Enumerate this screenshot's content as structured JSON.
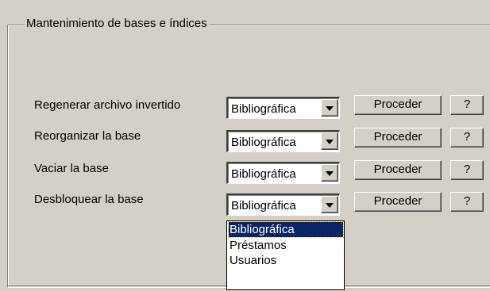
{
  "group": {
    "title": "Mantenimiento de bases e índices"
  },
  "rows": [
    {
      "label": "Regenerar archivo invertido",
      "combo_value": "Bibliográfica",
      "proceed_label": "Proceder",
      "help_label": "?"
    },
    {
      "label": "Reorganizar la base",
      "combo_value": "Bibliográfica",
      "proceed_label": "Proceder",
      "help_label": "?"
    },
    {
      "label": "Vaciar la base",
      "combo_value": "Bibliográfica",
      "proceed_label": "Proceder",
      "help_label": "?"
    },
    {
      "label": "Desbloquear la base",
      "combo_value": "Bibliográfica",
      "proceed_label": "Proceder",
      "help_label": "?"
    }
  ],
  "dropdown": {
    "options": [
      "Bibliográfica",
      "Préstamos",
      "Usuarios"
    ],
    "selected": "Bibliográfica"
  },
  "colors": {
    "face": "#d4d0c8",
    "highlight": "#0a246a"
  }
}
